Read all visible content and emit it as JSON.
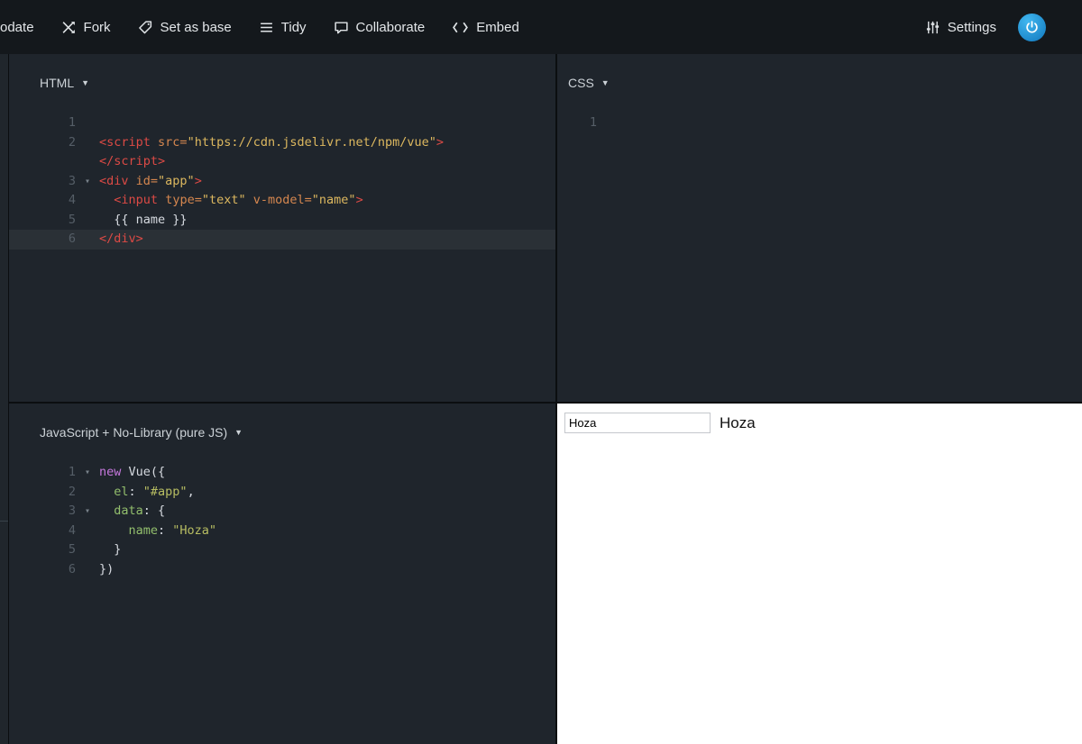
{
  "topbar": {
    "left_items": [
      {
        "name": "update",
        "label": "odate",
        "icon": ""
      },
      {
        "name": "fork",
        "label": "Fork",
        "icon": "fork-icon"
      },
      {
        "name": "set-as-base",
        "label": "Set as base",
        "icon": "tag-icon"
      },
      {
        "name": "tidy",
        "label": "Tidy",
        "icon": "tidy-lines-icon"
      },
      {
        "name": "collaborate",
        "label": "Collaborate",
        "icon": "chat-bubble-icon"
      },
      {
        "name": "embed",
        "label": "Embed",
        "icon": "code-brackets-icon"
      }
    ],
    "settings_label": "Settings"
  },
  "editors": {
    "html": {
      "title": "HTML",
      "caret": "▼",
      "lines": [
        {
          "num": "1",
          "tokens": []
        },
        {
          "num": "2",
          "tokens": [
            {
              "t": "tag",
              "v": "<script"
            },
            {
              "t": "pln",
              "v": " "
            },
            {
              "t": "attr",
              "v": "src="
            },
            {
              "t": "str",
              "v": "\"https://cdn.jsdelivr.net/npm/vue\""
            },
            {
              "t": "tag",
              "v": ">"
            }
          ]
        },
        {
          "num": "",
          "tokens": [
            {
              "t": "tag",
              "v": "</script>"
            }
          ]
        },
        {
          "num": "3",
          "fold": true,
          "tokens": [
            {
              "t": "tag",
              "v": "<div"
            },
            {
              "t": "pln",
              "v": " "
            },
            {
              "t": "attr",
              "v": "id="
            },
            {
              "t": "str",
              "v": "\"app\""
            },
            {
              "t": "tag",
              "v": ">"
            }
          ]
        },
        {
          "num": "4",
          "tokens": [
            {
              "t": "pln",
              "v": "  "
            },
            {
              "t": "tag",
              "v": "<input"
            },
            {
              "t": "pln",
              "v": " "
            },
            {
              "t": "attr",
              "v": "type="
            },
            {
              "t": "str",
              "v": "\"text\""
            },
            {
              "t": "pln",
              "v": " "
            },
            {
              "t": "attr",
              "v": "v-model="
            },
            {
              "t": "str",
              "v": "\"name\""
            },
            {
              "t": "tag",
              "v": ">"
            }
          ]
        },
        {
          "num": "5",
          "tokens": [
            {
              "t": "pln",
              "v": "  {{ name }}"
            }
          ]
        },
        {
          "num": "6",
          "active": true,
          "tokens": [
            {
              "t": "tag",
              "v": "</div>"
            }
          ]
        }
      ]
    },
    "css": {
      "title": "CSS",
      "caret": "▼",
      "lines": [
        {
          "num": "1",
          "tokens": []
        }
      ]
    },
    "js": {
      "title": "JavaScript + No-Library (pure JS)",
      "caret": "▼",
      "lines": [
        {
          "num": "1",
          "fold": true,
          "tokens": [
            {
              "t": "kw",
              "v": "new"
            },
            {
              "t": "pln",
              "v": " Vue({"
            }
          ]
        },
        {
          "num": "2",
          "tokens": [
            {
              "t": "pln",
              "v": "  "
            },
            {
              "t": "prop",
              "v": "el"
            },
            {
              "t": "pln",
              "v": ": "
            },
            {
              "t": "str2",
              "v": "\"#app\""
            },
            {
              "t": "pln",
              "v": ","
            }
          ]
        },
        {
          "num": "3",
          "fold": true,
          "tokens": [
            {
              "t": "pln",
              "v": "  "
            },
            {
              "t": "prop",
              "v": "data"
            },
            {
              "t": "pln",
              "v": ": {"
            }
          ]
        },
        {
          "num": "4",
          "tokens": [
            {
              "t": "pln",
              "v": "    "
            },
            {
              "t": "prop",
              "v": "name"
            },
            {
              "t": "pln",
              "v": ": "
            },
            {
              "t": "str2",
              "v": "\"Hoza\""
            }
          ]
        },
        {
          "num": "5",
          "tokens": [
            {
              "t": "pln",
              "v": "  }"
            }
          ]
        },
        {
          "num": "6",
          "tokens": [
            {
              "t": "pln",
              "v": "})"
            }
          ]
        }
      ]
    }
  },
  "result": {
    "input_value": "Hoza",
    "output_text": "Hoza"
  }
}
